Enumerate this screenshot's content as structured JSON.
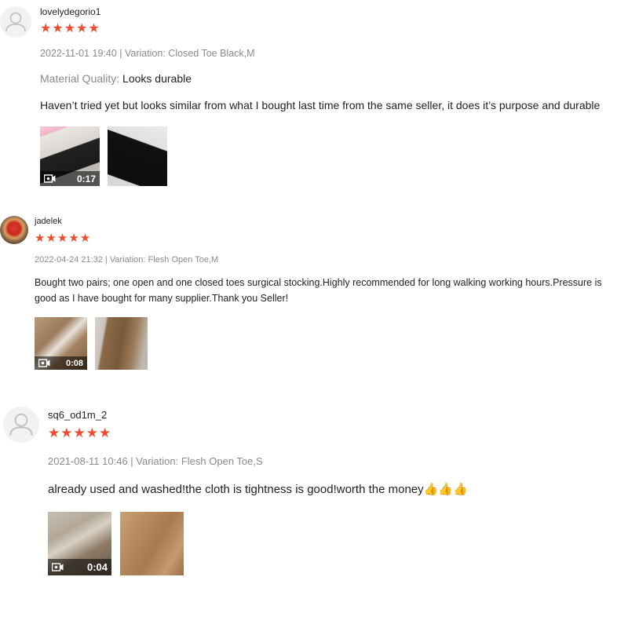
{
  "reviews": [
    {
      "username": "lovelydegorio1",
      "rating": 5,
      "stars": "★★★★★",
      "meta": "2022-11-01 19:40 | Variation: Closed Toe Black,M",
      "quality_label": "Material Quality:",
      "quality_value": "Looks durable",
      "comment_lines": [
        "Haven’t tried yet but looks similar from what I bought last time from the same seller, it does it’s purpose and durable"
      ],
      "video_duration": "0:17"
    },
    {
      "username": "jadelek",
      "rating": 5,
      "stars": "★★★★★",
      "meta": "2022-04-24 21:32 | Variation: Flesh Open Toe,M",
      "comment_lines": [
        "Bought two pairs; one open and one closed toes surgical stocking.Highly recommended for long walking working hours.Pressure is",
        "good as I have bought for many supplier.Thank you Seller!"
      ],
      "video_duration": "0:08"
    },
    {
      "username": "sq6_od1m_2",
      "rating": 5,
      "stars": "★★★★★",
      "meta": "2021-08-11 10:46 | Variation: Flesh Open Toe,S",
      "comment_lines": [
        "already used and washed!the cloth is tightness is good!worth the money👍👍👍"
      ],
      "video_duration": "0:04"
    }
  ]
}
